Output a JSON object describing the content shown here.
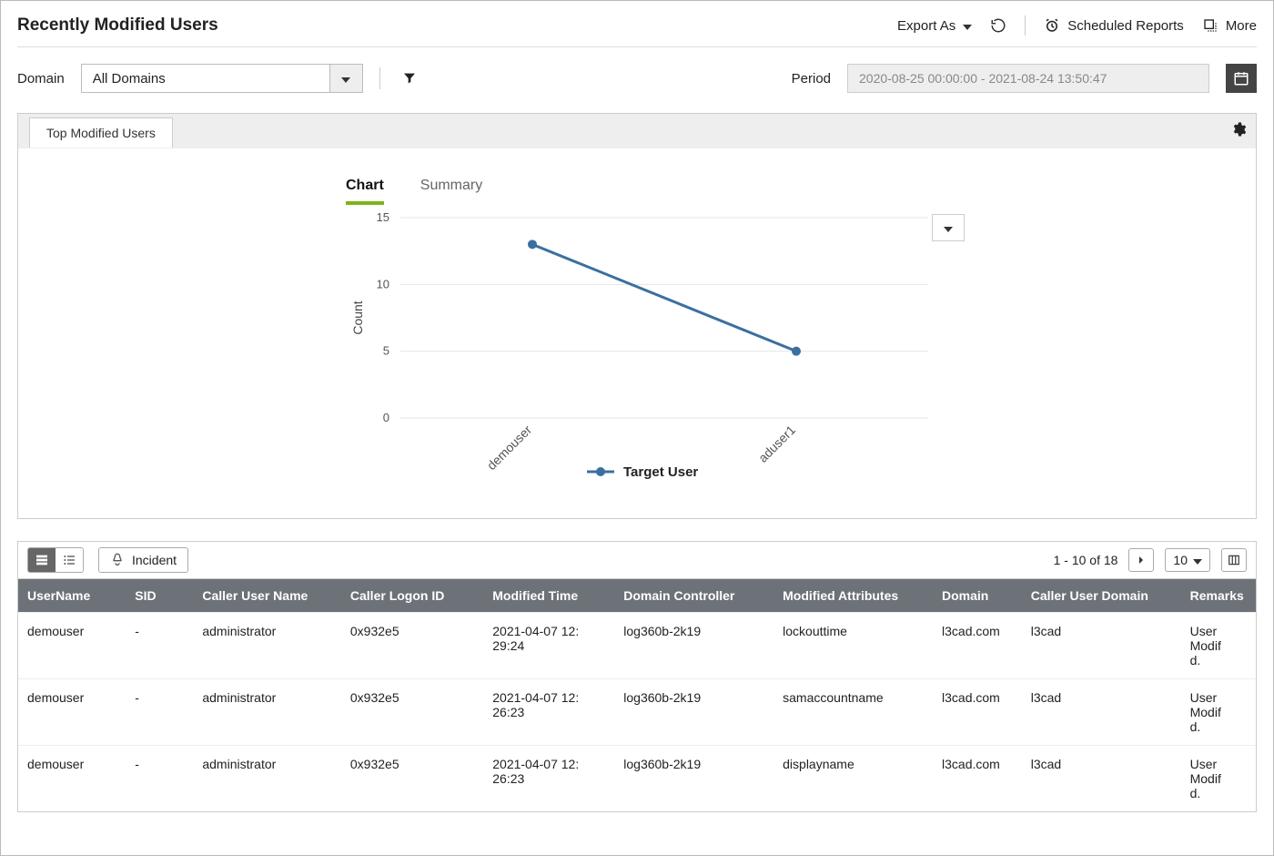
{
  "header": {
    "title": "Recently Modified Users",
    "export_label": "Export As",
    "scheduled_label": "Scheduled Reports",
    "more_label": "More"
  },
  "filter": {
    "domain_label": "Domain",
    "domain_value": "All Domains",
    "period_label": "Period",
    "period_value": "2020-08-25 00:00:00 - 2021-08-24 13:50:47"
  },
  "panel": {
    "tab_label": "Top Modified Users",
    "subtabs": {
      "chart": "Chart",
      "summary": "Summary"
    },
    "legend_label": "Target User",
    "y_title": "Count"
  },
  "chart_data": {
    "type": "line",
    "categories": [
      "demouser",
      "aduser1"
    ],
    "values": [
      13,
      5
    ],
    "yticks": [
      0,
      5,
      10,
      15
    ],
    "ylim": [
      0,
      15
    ],
    "ylabel": "Count",
    "series_name": "Target User"
  },
  "table": {
    "pager_text": "1 - 10 of 18",
    "page_size": "10",
    "incident_label": "Incident",
    "columns": [
      "UserName",
      "SID",
      "Caller User Name",
      "Caller Logon ID",
      "Modified Time",
      "Domain Controller",
      "Modified Attributes",
      "Domain",
      "Caller User Domain",
      "Remarks"
    ],
    "rows": [
      [
        "demouser",
        "-",
        "administrator",
        "0x932e5",
        "2021-04-07 12:29:24",
        "log360b-2k19",
        "lockouttime",
        "l3cad.com",
        "l3cad",
        "User Modified."
      ],
      [
        "demouser",
        "-",
        "administrator",
        "0x932e5",
        "2021-04-07 12:26:23",
        "log360b-2k19",
        "samaccountname",
        "l3cad.com",
        "l3cad",
        "User Modified."
      ],
      [
        "demouser",
        "-",
        "administrator",
        "0x932e5",
        "2021-04-07 12:26:23",
        "log360b-2k19",
        "displayname",
        "l3cad.com",
        "l3cad",
        "User Modified."
      ]
    ]
  }
}
